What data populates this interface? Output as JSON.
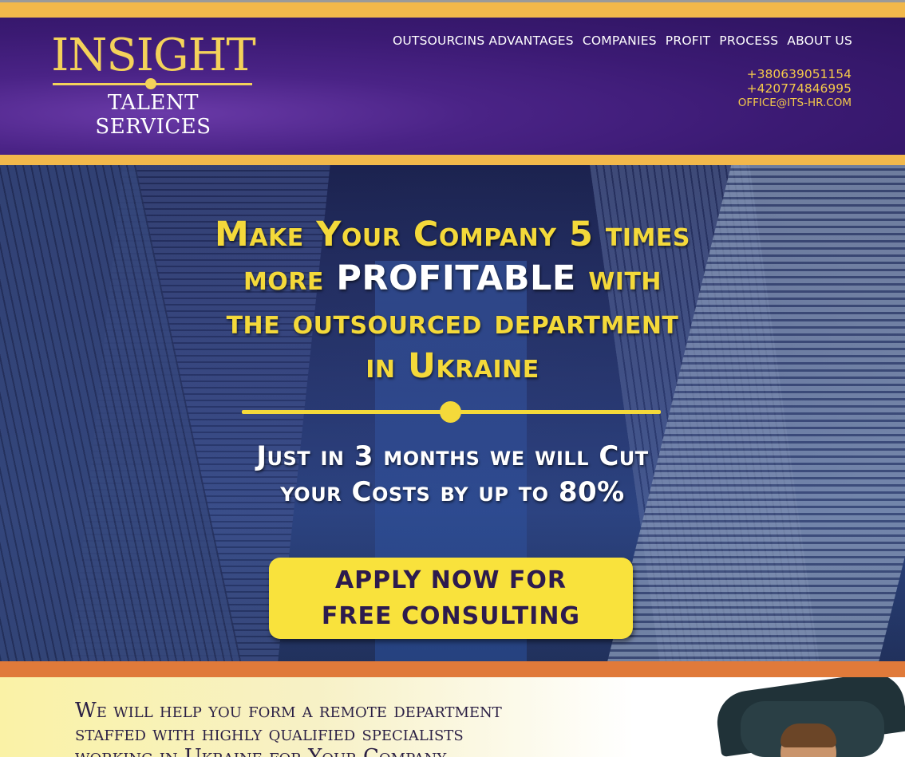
{
  "logo": {
    "top": "INSIGHT",
    "bottom": "TALENT SERVICES"
  },
  "nav": [
    {
      "label": "OUTSOURCINS ADVANTAGES"
    },
    {
      "label": "COMPANIES"
    },
    {
      "label": "PROFIT"
    },
    {
      "label": "PROCESS"
    },
    {
      "label": "ABOUT US"
    }
  ],
  "contact": {
    "phone1": "+380639051154",
    "phone2": "+420774846995",
    "email": "OFFICE@ITS-HR.COM"
  },
  "hero": {
    "line1": "Make Your Company 5 times",
    "line2_a": "more ",
    "line2_b": "PROFITABLE",
    "line2_c": " with",
    "line3": "the outsourced department",
    "line4": "in Ukraine",
    "sub1": "Just in 3 months we will Cut",
    "sub2": "your Costs by up to 80%",
    "cta": "APPLY NOW FOR\nFREE CONSULTING"
  },
  "intro": {
    "line1": "We will help you form a remote department",
    "line2": "staffed with highly qualified specialists",
    "line3": "working in Ukraine for Your Company"
  },
  "colors": {
    "gold": "#f2b84b",
    "headline_yellow": "#f4d93a",
    "header_purple": "#3b1a73",
    "cta_yellow": "#f9e23c",
    "orange": "#e07a3a"
  }
}
